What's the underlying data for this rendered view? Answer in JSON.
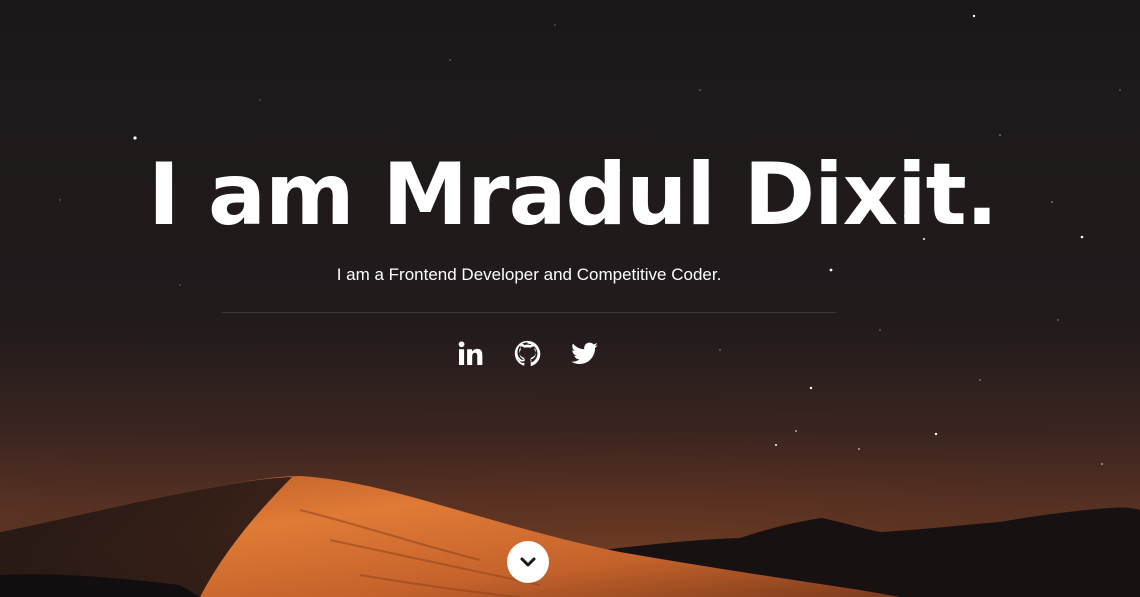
{
  "hero": {
    "headline": "I am Mradul Dixit.",
    "tagline": "I am a Frontend Developer and Competitive Coder."
  },
  "social_links": [
    {
      "icon": "linkedin-icon",
      "label": "LinkedIn"
    },
    {
      "icon": "github-icon",
      "label": "GitHub"
    },
    {
      "icon": "twitter-icon",
      "label": "Twitter"
    }
  ],
  "scroll_button": {
    "icon": "chevron-down-icon"
  },
  "colors": {
    "sky": "#1b1719",
    "dune_glow": "#d9733a",
    "text": "#ffffff"
  }
}
